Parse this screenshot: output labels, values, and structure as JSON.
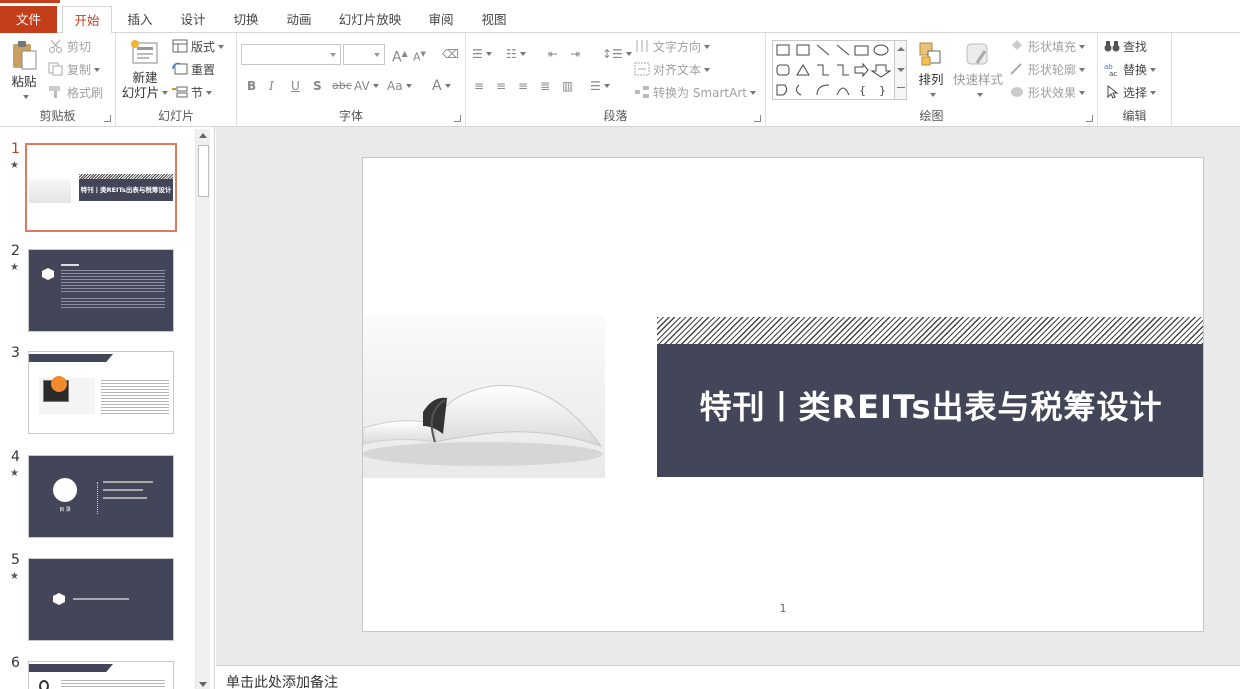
{
  "tabs": {
    "file": "文件",
    "home": "开始",
    "insert": "插入",
    "design": "设计",
    "transitions": "切换",
    "animations": "动画",
    "slideshow": "幻灯片放映",
    "review": "审阅",
    "view": "视图"
  },
  "clipboard": {
    "paste": "粘贴",
    "cut": "剪切",
    "copy": "复制",
    "format_painter": "格式刷",
    "label": "剪贴板"
  },
  "slides_group": {
    "new_slide_line1": "新建",
    "new_slide_line2": "幻灯片",
    "layout": "版式",
    "reset": "重置",
    "section": "节",
    "label": "幻灯片"
  },
  "font_group": {
    "label": "字体",
    "bold": "B",
    "italic": "I",
    "underline": "U",
    "shadow": "S",
    "strike": "abc",
    "spacing": "AV",
    "case": "Aa",
    "color": "A",
    "grow": "A",
    "shrink": "A"
  },
  "paragraph_group": {
    "text_direction": "文字方向",
    "align_text": "对齐文本",
    "convert_smartart": "转换为 SmartArt",
    "label": "段落"
  },
  "drawing_group": {
    "arrange": "排列",
    "quick_styles": "快速样式",
    "shape_fill": "形状填充",
    "shape_outline": "形状轮廓",
    "shape_effects": "形状效果",
    "label": "绘图"
  },
  "editing_group": {
    "find": "查找",
    "replace": "替换",
    "select": "选择",
    "label": "编辑"
  },
  "thumbnails": [
    "1",
    "2",
    "3",
    "4",
    "5",
    "6"
  ],
  "thumb_texts": {
    "t1_title": "特刊丨类REITs出表与税筹设计",
    "t4_label": "目 录"
  },
  "slide": {
    "title": "特刊丨类REITs出表与税筹设计",
    "page_number": "1"
  },
  "notes": {
    "placeholder": "单击此处添加备注"
  },
  "colors": {
    "accent": "#c43e1c",
    "banner": "#434658",
    "selected_thumb": "#e07a5f"
  }
}
